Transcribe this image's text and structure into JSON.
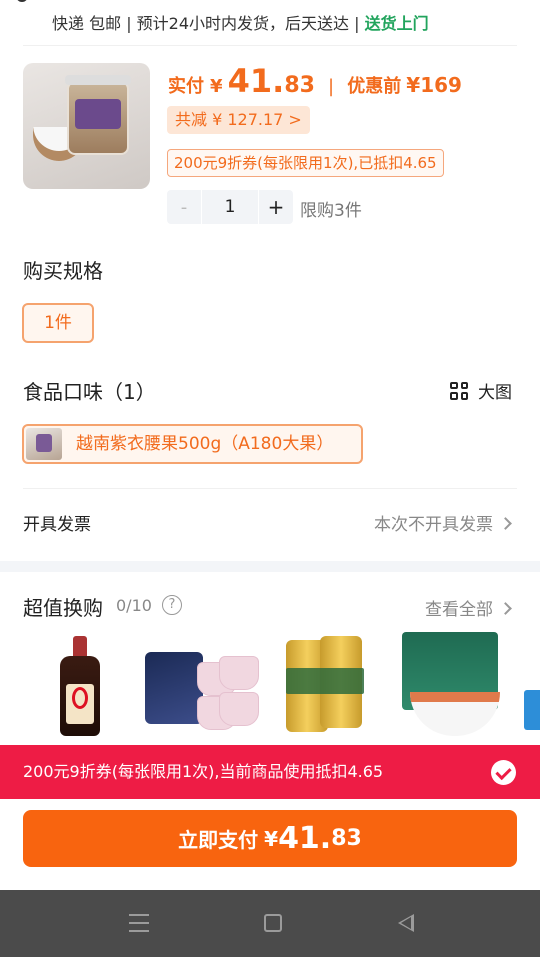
{
  "shipping": {
    "method": "快递 包邮",
    "estimate": "预计24小时内发货，后天送达",
    "door": "送货上门"
  },
  "product": {
    "pay_label": "实付",
    "currency": "¥",
    "pay_int": "41.",
    "pay_dec": "83",
    "original_label": "优惠前",
    "original_price": "¥169",
    "reduce_text": "共减 ¥ 127.17 >",
    "coupon_text": "200元9折券(每张限用1次),已抵扣4.65",
    "minus": "-",
    "quantity": "1",
    "plus": "+",
    "limit_text": "限购3件"
  },
  "spec": {
    "title": "购买规格",
    "option": "1件"
  },
  "flavor": {
    "title": "食品口味（1）",
    "bigview": "大图",
    "option": "越南紫衣腰果500g（A180大果）"
  },
  "invoice": {
    "label": "开具发票",
    "value": "本次不开具发票"
  },
  "swap": {
    "title": "超值换购",
    "count": "0/10",
    "help": "?",
    "view_all": "查看全部",
    "items": [
      "soy-sauce-bottle",
      "sanitary-pants-pack",
      "beer-can-pack",
      "fruit-chips-bag",
      "tissue-box"
    ]
  },
  "coupon_bar": {
    "text": "200元9折券(每张限用1次),当前商品使用抵扣4.65"
  },
  "pay_button": {
    "label": "立即支付",
    "currency": "¥",
    "int": "41.",
    "dec": "83"
  },
  "colors": {
    "accent": "#f26b1d",
    "pay_button": "#f8640f",
    "coupon_bar": "#ee1c45",
    "green": "#22a45d"
  }
}
